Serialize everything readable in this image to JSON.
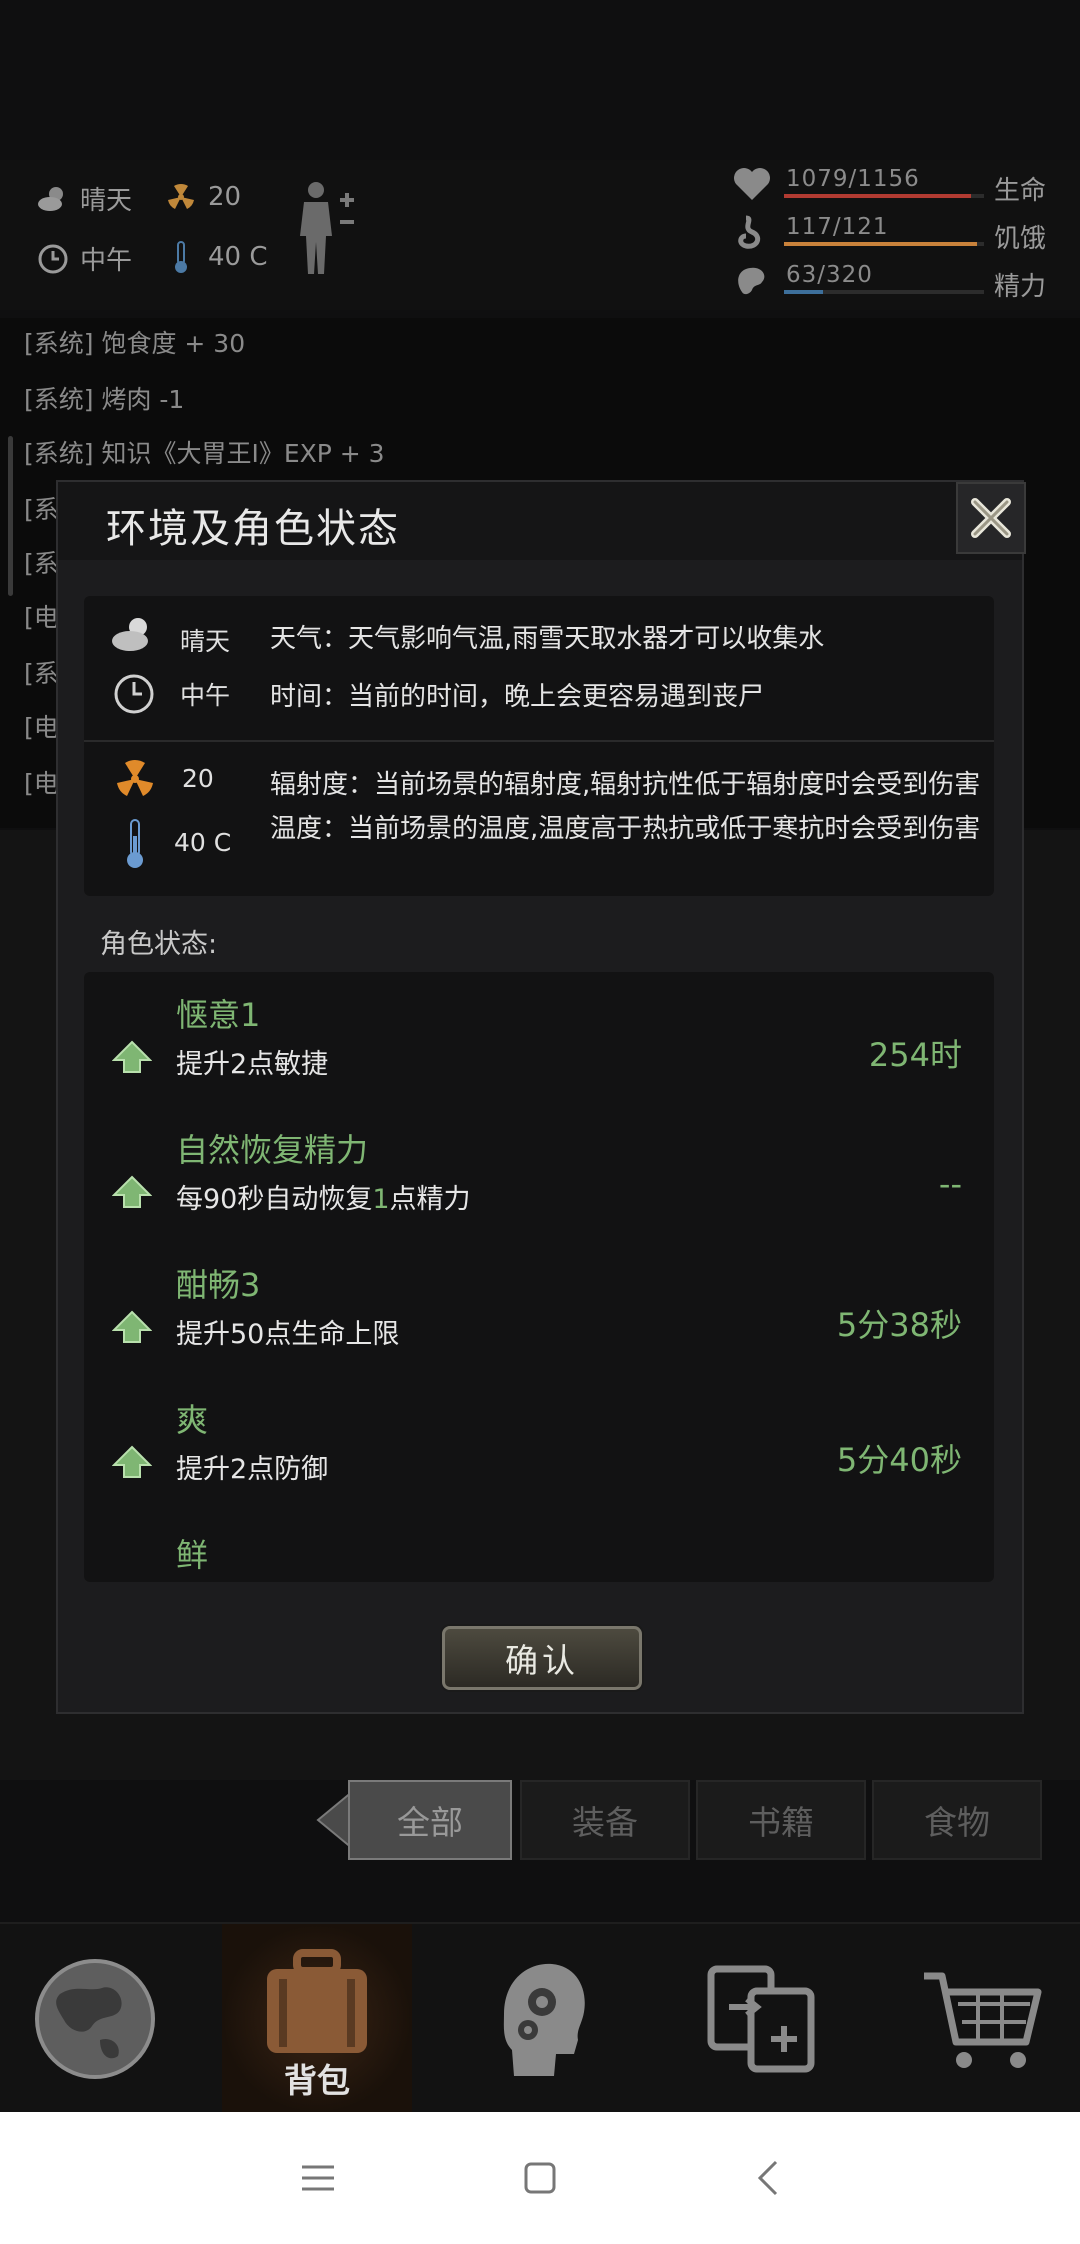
{
  "hud": {
    "weather": "晴天",
    "radiation": "20",
    "time_of_day": "中午",
    "temperature": "40 C",
    "stats": [
      {
        "value": "1079/1156",
        "label": "生命",
        "fraction": 0.933,
        "color": "#b23b32"
      },
      {
        "value": "117/121",
        "label": "饥饿",
        "fraction": 0.967,
        "color": "#c9823b"
      },
      {
        "value": "63/320",
        "label": "精力",
        "fraction": 0.197,
        "color": "#3d6f9b"
      }
    ]
  },
  "log": {
    "lines": [
      "[系统] 饱食度 + 30",
      "[系统] 烤肉 -1",
      "[系统] 知识《大胃王Ⅰ》EXP + 3",
      "[系",
      "[系",
      "[电",
      "[系",
      "[电",
      "[电"
    ]
  },
  "modal": {
    "title": "环境及角色状态",
    "env": {
      "weather_value": "晴天",
      "weather_desc": "天气：天气影响气温,雨雪天取水器才可以收集水",
      "time_value": "中午",
      "time_desc": "时间：当前的时间，晚上会更容易遇到丧尸",
      "radiation_value": "20",
      "radiation_desc": "辐射度：当前场景的辐射度,辐射抗性低于辐射度时会受到伤害",
      "temperature_value": "40 C",
      "temperature_desc": "温度：当前场景的温度,温度高于热抗或低于寒抗时会受到伤害"
    },
    "role_label": "角色状态:",
    "statuses": [
      {
        "name": "惬意1",
        "desc": "提升2点敏捷",
        "time": "254时"
      },
      {
        "name": "自然恢复精力",
        "desc_pre": "每90秒自动恢复",
        "desc_hl": "1",
        "desc_post": "点精力",
        "time": "--"
      },
      {
        "name": "酣畅3",
        "desc": "提升50点生命上限",
        "time": "5分38秒"
      },
      {
        "name": "爽",
        "desc": "提升2点防御",
        "time": "5分40秒"
      },
      {
        "name": "鲜",
        "desc": "",
        "time": ""
      }
    ],
    "confirm_label": "确认"
  },
  "tabs": [
    {
      "label": "全部",
      "active": true
    },
    {
      "label": "装备",
      "active": false
    },
    {
      "label": "书籍",
      "active": false
    },
    {
      "label": "食物",
      "active": false
    }
  ],
  "bottom_nav": {
    "active_label": "背包",
    "icons": [
      "globe-icon",
      "backpack-icon",
      "head-gears-icon",
      "transfer-icon",
      "cart-icon"
    ]
  },
  "colors": {
    "accent_green": "#7fb673",
    "modal_bg": "#1c1c1e"
  }
}
